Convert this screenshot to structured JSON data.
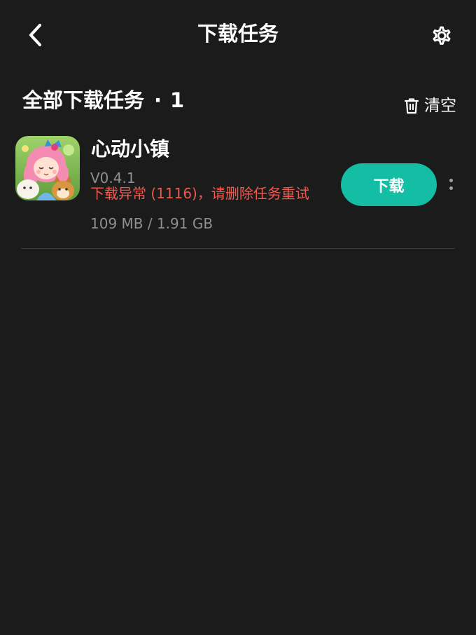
{
  "header": {
    "title": "下载任务",
    "back_icon": "chevron-left-icon",
    "settings_icon": "gear-icon"
  },
  "section": {
    "title": "全部下载任务",
    "separator": "·",
    "count": "1",
    "clear_label": "清空",
    "clear_icon": "trash-icon"
  },
  "tasks": [
    {
      "name": "心动小镇",
      "version": "V0.4.1",
      "error": "下载异常 (1116)，请删除任务重试",
      "size": "109 MB / 1.91 GB",
      "action_label": "下载"
    }
  ],
  "colors": {
    "background": "#1b1b1b",
    "accent": "#13bea5",
    "error": "#ef5a4e",
    "muted_text": "#8f8f8f"
  }
}
